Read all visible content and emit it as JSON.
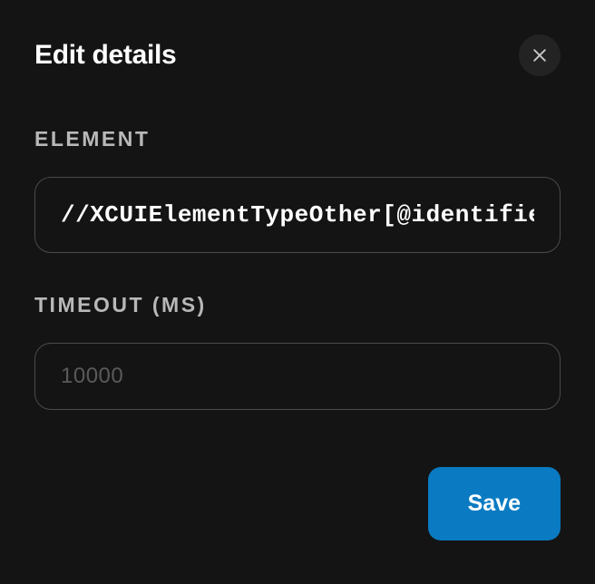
{
  "modal": {
    "title": "Edit details",
    "fields": {
      "element": {
        "label": "ELEMENT",
        "value": "//XCUIElementTypeOther[@identifier='ca"
      },
      "timeout": {
        "label": "TIMEOUT (MS)",
        "value": "",
        "placeholder": "10000"
      }
    },
    "buttons": {
      "save": "Save"
    }
  }
}
